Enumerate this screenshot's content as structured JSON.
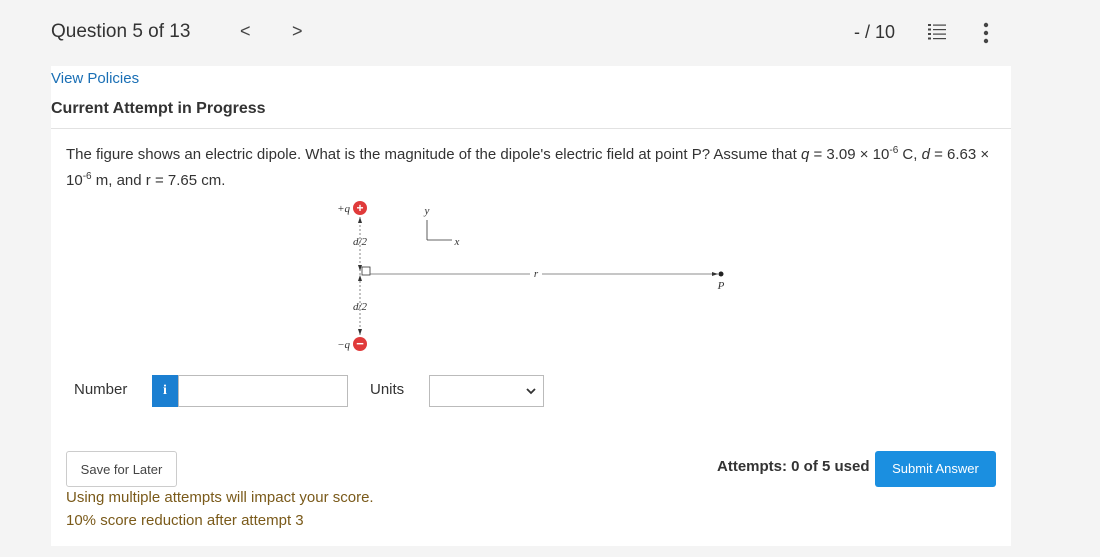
{
  "header": {
    "question_title": "Question 5 of 13",
    "prev_label": "<",
    "next_label": ">",
    "score": "- / 10",
    "list_icon": "list-icon",
    "more_icon": "more-vertical-icon"
  },
  "policies_link": "View Policies",
  "attempt_heading": "Current Attempt in Progress",
  "question": {
    "text_a": "The figure shows an electric dipole. What is the magnitude of the dipole's electric field at point P? Assume that ",
    "q_sym": "q",
    "text_b": " = 3.09 × 10",
    "exp1": "-6",
    "text_c": " C, ",
    "d_sym": "d",
    "text_d": " = 6.63 × 10",
    "exp2": "-6",
    "text_e": " m, and r = 7.65 cm."
  },
  "figure": {
    "plus_label": "+q",
    "minus_label": "−q",
    "half_top": "d/2",
    "half_bottom": "d/2",
    "y_axis": "y",
    "x_axis": "x",
    "r_label": "r",
    "p_label": "P",
    "plus_sign": "+",
    "minus_sign": "−"
  },
  "answer": {
    "number_label": "Number",
    "info_label": "i",
    "number_value": "",
    "units_label": "Units",
    "units_selected": ""
  },
  "footer": {
    "save_label": "Save for Later",
    "attempts_text": "Attempts: 0 of 5 used",
    "submit_label": "Submit Answer",
    "warning_1": "Using multiple attempts will impact your score.",
    "warning_2": "10% score reduction after attempt 3"
  },
  "colors": {
    "accent": "#1b8fe0",
    "info": "#1b7fd1",
    "charge": "#e03a3a",
    "warning_text": "#7a5a1a"
  }
}
